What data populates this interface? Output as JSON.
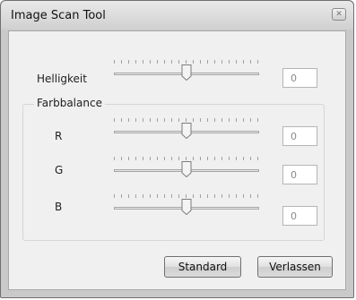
{
  "window": {
    "title": "Image Scan Tool",
    "close_glyph": "✕"
  },
  "brightness": {
    "label": "Helligkeit",
    "value": "0",
    "level": 0.5
  },
  "color_balance": {
    "title": "Farbbalance",
    "channels": [
      {
        "label": "R",
        "value": "0",
        "level": 0.5
      },
      {
        "label": "G",
        "value": "0",
        "level": 0.5
      },
      {
        "label": "B",
        "value": "0",
        "level": 0.5
      }
    ]
  },
  "buttons": {
    "standard": "Standard",
    "exit": "Verlassen"
  }
}
